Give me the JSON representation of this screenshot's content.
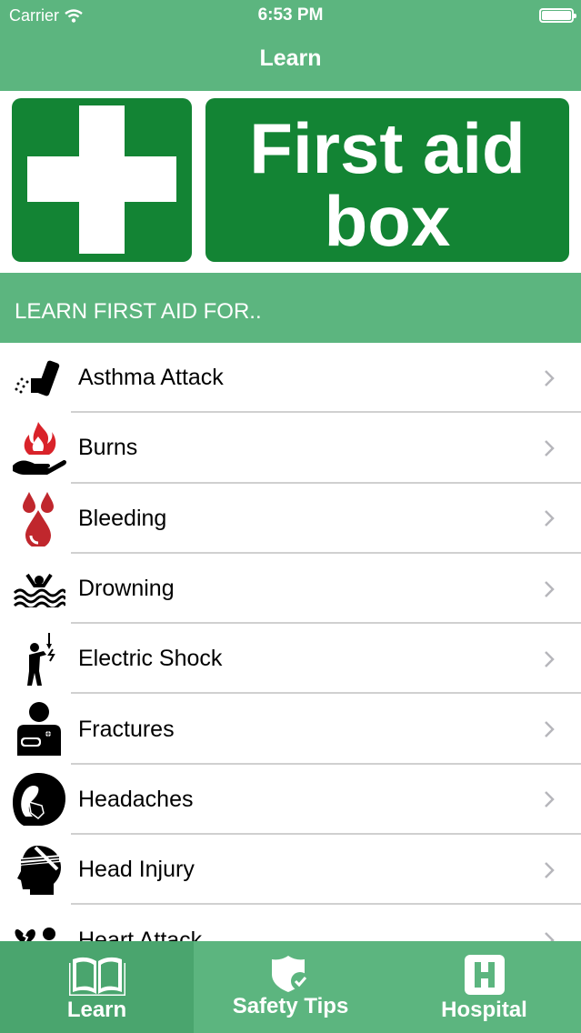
{
  "status": {
    "carrier": "Carrier",
    "time": "6:53 PM"
  },
  "nav": {
    "title": "Learn"
  },
  "banner": {
    "line1": "First aid",
    "line2": "box"
  },
  "section": {
    "header": "LEARN FIRST AID FOR.."
  },
  "items": [
    {
      "label": "Asthma Attack",
      "icon": "inhaler-icon"
    },
    {
      "label": "Burns",
      "icon": "fire-hand-icon"
    },
    {
      "label": "Bleeding",
      "icon": "blood-drops-icon"
    },
    {
      "label": "Drowning",
      "icon": "drowning-icon"
    },
    {
      "label": "Electric Shock",
      "icon": "electric-shock-icon"
    },
    {
      "label": "Fractures",
      "icon": "fracture-icon"
    },
    {
      "label": "Headaches",
      "icon": "headache-icon"
    },
    {
      "label": "Head Injury",
      "icon": "head-bandage-icon"
    },
    {
      "label": "Heart Attack",
      "icon": "heart-attack-icon"
    }
  ],
  "tabs": [
    {
      "label": "Learn",
      "icon": "book-icon",
      "active": true
    },
    {
      "label": "Safety Tips",
      "icon": "shield-check-icon",
      "active": false
    },
    {
      "label": "Hospital",
      "icon": "hospital-icon",
      "active": false
    }
  ],
  "colors": {
    "header_green": "#5cb57f",
    "tab_active": "#4aa56e",
    "banner_green": "#138434"
  }
}
